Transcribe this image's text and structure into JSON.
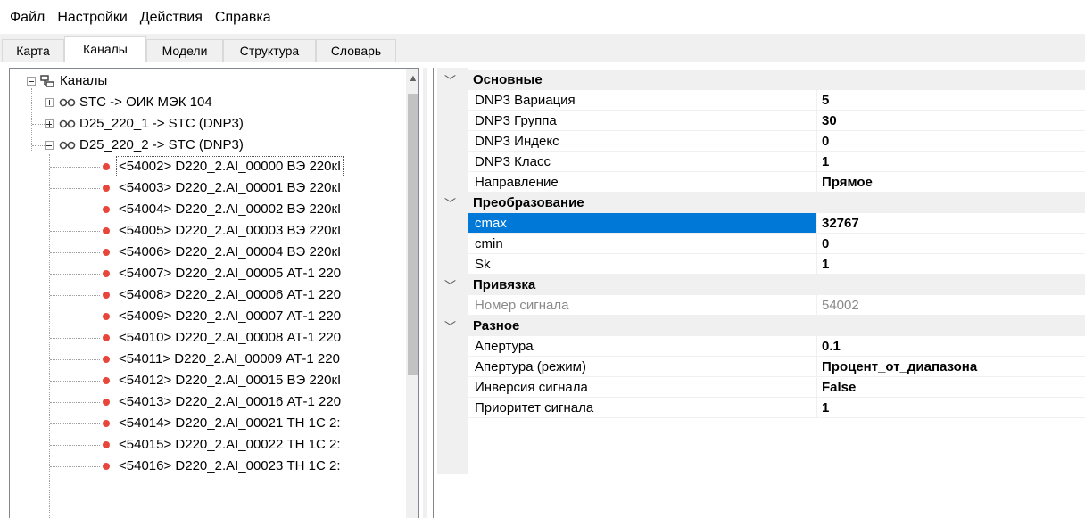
{
  "menu": [
    "Файл",
    "Настройки",
    "Действия",
    "Справка"
  ],
  "tabs": [
    "Карта",
    "Каналы",
    "Модели",
    "Структура",
    "Словарь"
  ],
  "active_tab": "Каналы",
  "tree": {
    "root": "Каналы",
    "groups": [
      "STC -> ОИК МЭК 104",
      "D25_220_1 -> STC (DNP3)",
      "D25_220_2 -> STC (DNP3)"
    ],
    "items": [
      "<54002> D220_2.AI_00000 ВЭ 220кI",
      "<54003> D220_2.AI_00001 ВЭ 220кI",
      "<54004> D220_2.AI_00002 ВЭ 220кI",
      "<54005> D220_2.AI_00003 ВЭ 220кI",
      "<54006> D220_2.AI_00004 ВЭ 220кI",
      "<54007> D220_2.AI_00005 АТ-1 220",
      "<54008> D220_2.AI_00006 АТ-1 220",
      "<54009> D220_2.AI_00007 АТ-1 220",
      "<54010> D220_2.AI_00008 АТ-1 220",
      "<54011> D220_2.AI_00009 АТ-1 220",
      "<54012> D220_2.AI_00015 ВЭ 220кI",
      "<54013> D220_2.AI_00016 АТ-1 220",
      "<54014> D220_2.AI_00021 ТН 1С 2:",
      "<54015> D220_2.AI_00022 ТН 1С 2:",
      "<54016> D220_2.AI_00023 ТН 1С 2:"
    ]
  },
  "properties": {
    "categories": [
      {
        "label": "Основные",
        "rows": [
          {
            "name": "DNP3 Вариация",
            "value": "5"
          },
          {
            "name": "DNP3 Группа",
            "value": "30"
          },
          {
            "name": "DNP3 Индекс",
            "value": "0"
          },
          {
            "name": "DNP3 Класс",
            "value": "1"
          },
          {
            "name": "Направление",
            "value": "Прямое"
          }
        ]
      },
      {
        "label": "Преобразование",
        "rows": [
          {
            "name": "cmax",
            "value": "32767"
          },
          {
            "name": "cmin",
            "value": "0"
          },
          {
            "name": "Sk",
            "value": "1"
          }
        ]
      },
      {
        "label": "Привязка",
        "rows": [
          {
            "name": "Номер сигнала",
            "value": "54002"
          }
        ]
      },
      {
        "label": "Разное",
        "rows": [
          {
            "name": "Апертура",
            "value": "0.1"
          },
          {
            "name": "Апертура (режим)",
            "value": "Процент_от_диапазона"
          },
          {
            "name": "Инверсия сигнала",
            "value": "False"
          },
          {
            "name": "Приоритет сигнала",
            "value": "1"
          }
        ]
      }
    ]
  },
  "colors": {
    "selection": "#0078d7",
    "status_dot": "#e8463a"
  },
  "icons": [
    "expand-icon",
    "collapse-icon",
    "network-icon",
    "channel-icon",
    "status-dot-icon",
    "chevron-down-icon",
    "scroll-up-icon"
  ]
}
